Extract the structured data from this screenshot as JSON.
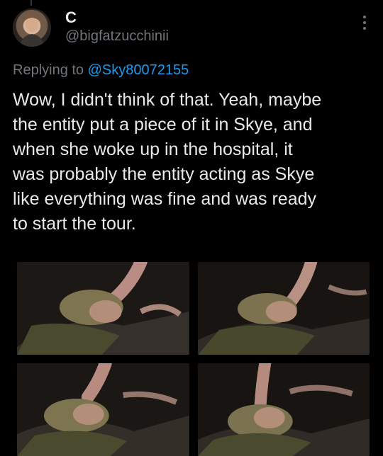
{
  "tweet": {
    "display_name": "C",
    "handle": "@bigfatzucchinii",
    "replying_prefix": "Replying to ",
    "replying_to": "@Sky80072155",
    "text": "Wow, I didn't think of that. Yeah, maybe\nthe entity put a piece of it in Skye, and\nwhen she woke up in the hospital, it\nwas probably the entity acting as Skye\nlike everything was fine and was ready\nto start the tour."
  },
  "media": {
    "count": 4,
    "image_icon": "image"
  },
  "colors": {
    "background": "#000000",
    "text": "#e7e9ea",
    "secondary": "#71767b",
    "link": "#1d9bf0"
  },
  "icons": {
    "more": "more-vertical-icon"
  }
}
